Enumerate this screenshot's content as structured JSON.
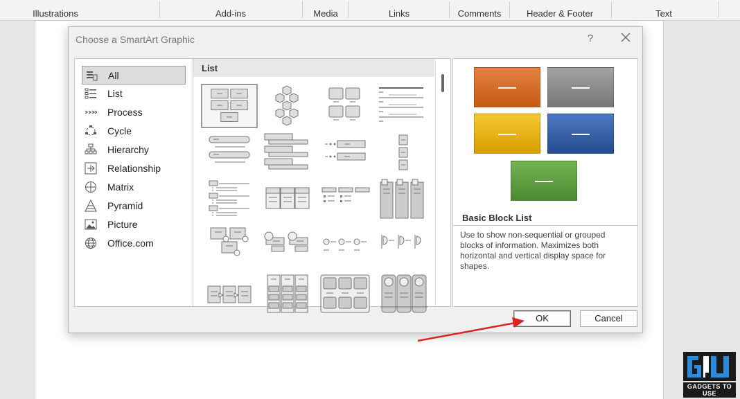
{
  "ribbon": {
    "groups": [
      {
        "label": "Illustrations"
      },
      {
        "label": "Add-ins"
      },
      {
        "label": "Media"
      },
      {
        "label": "Links"
      },
      {
        "label": "Comments"
      },
      {
        "label": "Header & Footer"
      },
      {
        "label": "Text"
      }
    ]
  },
  "dialog": {
    "title": "Choose a SmartArt Graphic",
    "help": "?",
    "categories": [
      {
        "label": "All",
        "icon": "all-icon",
        "selected": true
      },
      {
        "label": "List",
        "icon": "list-icon"
      },
      {
        "label": "Process",
        "icon": "process-icon"
      },
      {
        "label": "Cycle",
        "icon": "cycle-icon"
      },
      {
        "label": "Hierarchy",
        "icon": "hierarchy-icon"
      },
      {
        "label": "Relationship",
        "icon": "relationship-icon"
      },
      {
        "label": "Matrix",
        "icon": "matrix-icon"
      },
      {
        "label": "Pyramid",
        "icon": "pyramid-icon"
      },
      {
        "label": "Picture",
        "icon": "picture-icon"
      },
      {
        "label": "Office.com",
        "icon": "globe-icon"
      }
    ],
    "gallery": {
      "header": "List",
      "selected_index": 0
    },
    "preview": {
      "colors": [
        "#e06a1f",
        "#8c8c8c",
        "#f2b70a",
        "#2f5ea8",
        "#5c9e3e"
      ],
      "name": "Basic Block List",
      "description": "Use to show non-sequential or grouped blocks of information. Maximizes both horizontal and vertical display space for shapes."
    },
    "buttons": {
      "ok": "OK",
      "cancel": "Cancel"
    }
  },
  "logo": {
    "text": "GADGETS TO USE"
  }
}
